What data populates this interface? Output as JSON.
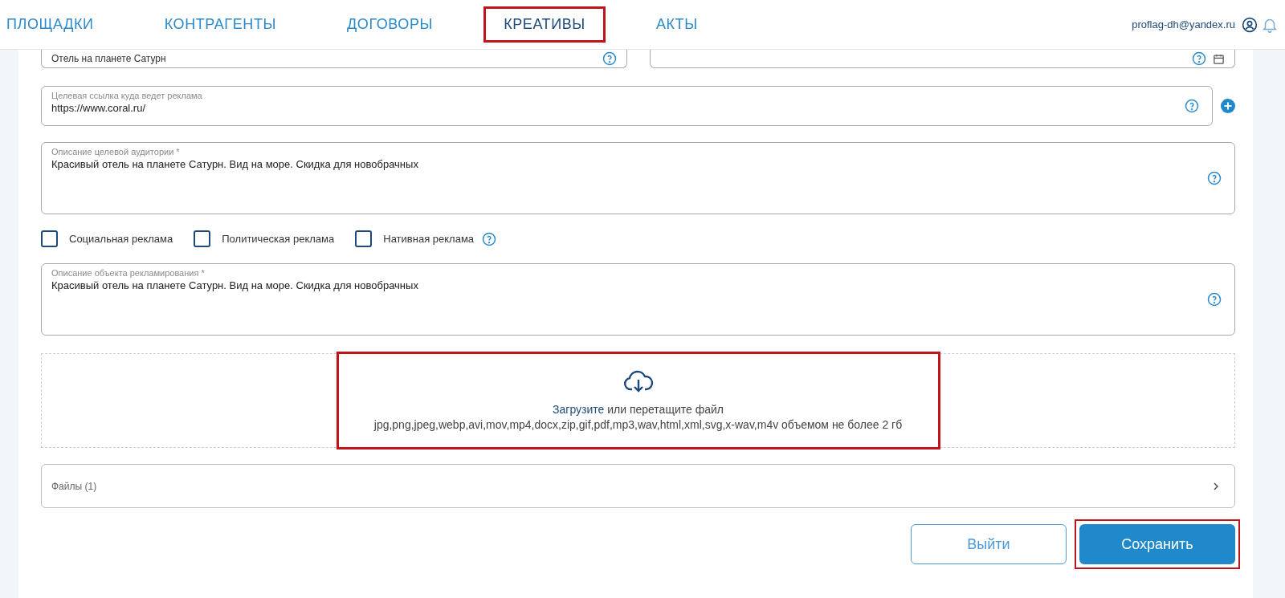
{
  "nav": {
    "tabs": [
      {
        "label": "ПЛОЩАДКИ",
        "selected": false,
        "highlighted": false
      },
      {
        "label": "КОНТРАГЕНТЫ",
        "selected": false,
        "highlighted": false
      },
      {
        "label": "ДОГОВОРЫ",
        "selected": false,
        "highlighted": false
      },
      {
        "label": "КРЕАТИВЫ",
        "selected": true,
        "highlighted": true
      },
      {
        "label": "АКТЫ",
        "selected": false,
        "highlighted": false
      }
    ],
    "user_email": "proflag-dh@yandex.ru"
  },
  "form": {
    "name_field": {
      "value": "Отель на планете Сатурн"
    },
    "target_link": {
      "label": "Целевая ссылка куда ведет реклама",
      "value": "https://www.coral.ru/"
    },
    "audience": {
      "label": "Описание целевой аудитории *",
      "value": "Красивый отель на планете Сатурн. Вид на море. Скидка для новобрачных"
    },
    "checkboxes": [
      {
        "label": "Социальная реклама",
        "checked": false,
        "help": false
      },
      {
        "label": "Политическая реклама",
        "checked": false,
        "help": false
      },
      {
        "label": "Нативная реклама",
        "checked": false,
        "help": true
      }
    ],
    "object_description": {
      "label": "Описание объекта рекламирования *",
      "value": "Красивый отель на планете Сатурн. Вид на море. Скидка для новобрачных"
    },
    "upload": {
      "link": "Загрузите",
      "text": "или перетащите файл",
      "formats": "jpg,png,jpeg,webp,avi,mov,mp4,docx,zip,gif,pdf,mp3,wav,html,xml,svg,x-wav,m4v объемом не более 2 гб",
      "highlighted": true
    },
    "files": {
      "label": "Файлы (1)",
      "expanded": false
    },
    "buttons": [
      {
        "label": "Выйти",
        "kind": "secondary"
      },
      {
        "label": "Сохранить",
        "kind": "primary",
        "highlighted": true
      }
    ]
  }
}
